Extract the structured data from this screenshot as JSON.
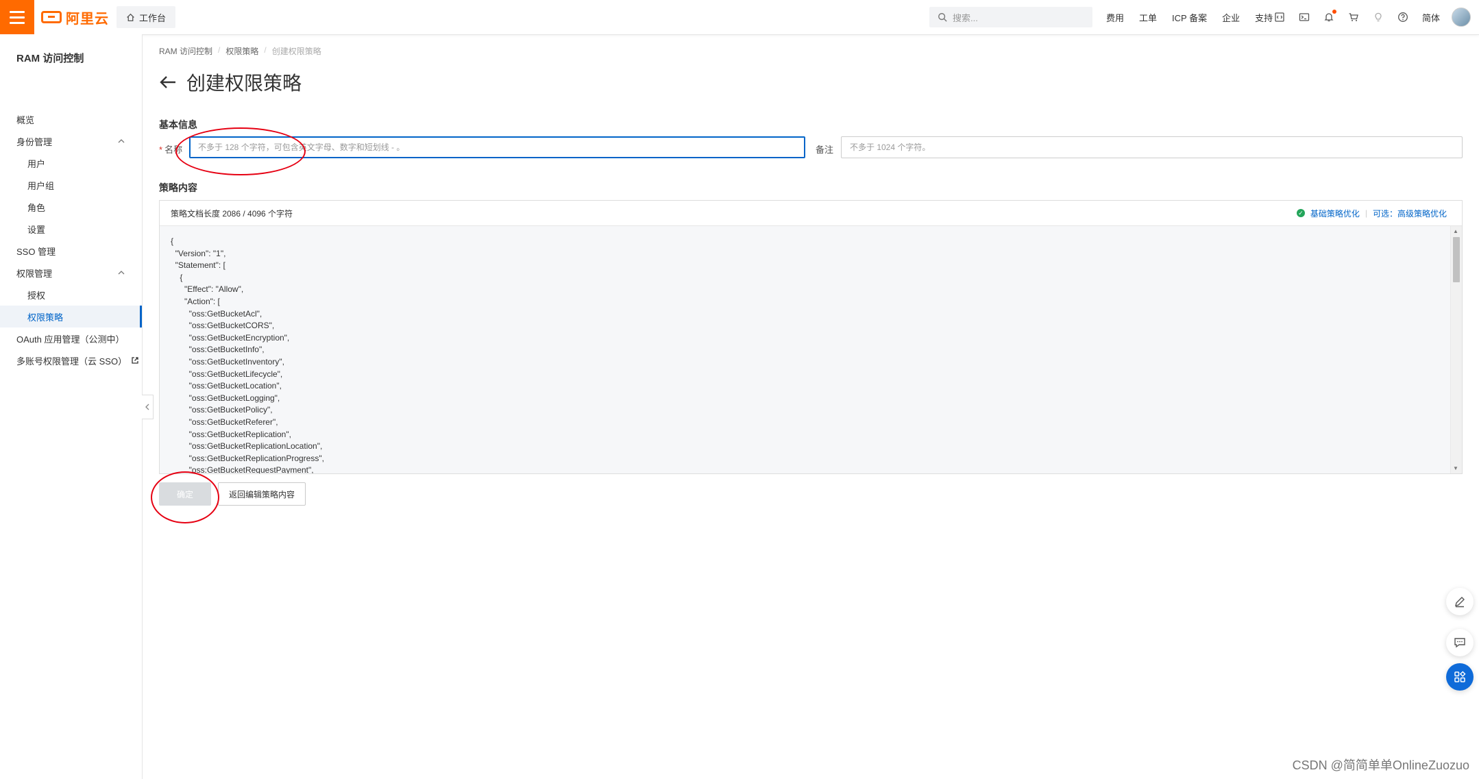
{
  "topbar": {
    "brand": "阿里云",
    "workbench": "工作台",
    "search_placeholder": "搜索...",
    "links": [
      "费用",
      "工单",
      "ICP 备案",
      "企业",
      "支持"
    ],
    "lang": "简体",
    "icons": [
      "code-icon",
      "terminal-icon",
      "bell-icon",
      "cart-icon",
      "bulb-icon",
      "help-icon"
    ]
  },
  "sidebar": {
    "title": "RAM 访问控制",
    "items": [
      {
        "label": "概览"
      },
      {
        "label": "身份管理"
      },
      {
        "label": "用户"
      },
      {
        "label": "用户组"
      },
      {
        "label": "角色"
      },
      {
        "label": "设置"
      },
      {
        "label": "SSO 管理"
      },
      {
        "label": "权限管理"
      },
      {
        "label": "授权"
      },
      {
        "label": "权限策略"
      },
      {
        "label": "OAuth 应用管理（公测中）"
      },
      {
        "label": "多账号权限管理（云 SSO）"
      }
    ]
  },
  "breadcrumb": [
    "RAM 访问控制",
    "权限策略",
    "创建权限策略"
  ],
  "page_title": "创建权限策略",
  "basic_info": {
    "section": "基本信息",
    "name_label": "名称",
    "name_placeholder": "不多于 128 个字符，可包含英文字母、数字和短划线 - 。",
    "remark_label": "备注",
    "remark_placeholder": "不多于 1024 个字符。"
  },
  "policy": {
    "section": "策略内容",
    "length_text": "策略文档长度 2086 / 4096 个字符",
    "basic_optimize": "基础策略优化",
    "optional_advanced": "可选：高级策略优化",
    "document": "{\n  \"Version\": \"1\",\n  \"Statement\": [\n    {\n      \"Effect\": \"Allow\",\n      \"Action\": [\n        \"oss:GetBucketAcl\",\n        \"oss:GetBucketCORS\",\n        \"oss:GetBucketEncryption\",\n        \"oss:GetBucketInfo\",\n        \"oss:GetBucketInventory\",\n        \"oss:GetBucketLifecycle\",\n        \"oss:GetBucketLocation\",\n        \"oss:GetBucketLogging\",\n        \"oss:GetBucketPolicy\",\n        \"oss:GetBucketReferer\",\n        \"oss:GetBucketReplication\",\n        \"oss:GetBucketReplicationLocation\",\n        \"oss:GetBucketReplicationProgress\",\n        \"oss:GetBucketRequestPayment\","
  },
  "actions": {
    "ok": "确定",
    "back_edit": "返回编辑策略内容"
  },
  "watermark": "CSDN @简简单单OnlineZuozuo",
  "colors": {
    "brand": "#ff6a00",
    "primary": "#0064c8",
    "annotation": "#e60012"
  }
}
